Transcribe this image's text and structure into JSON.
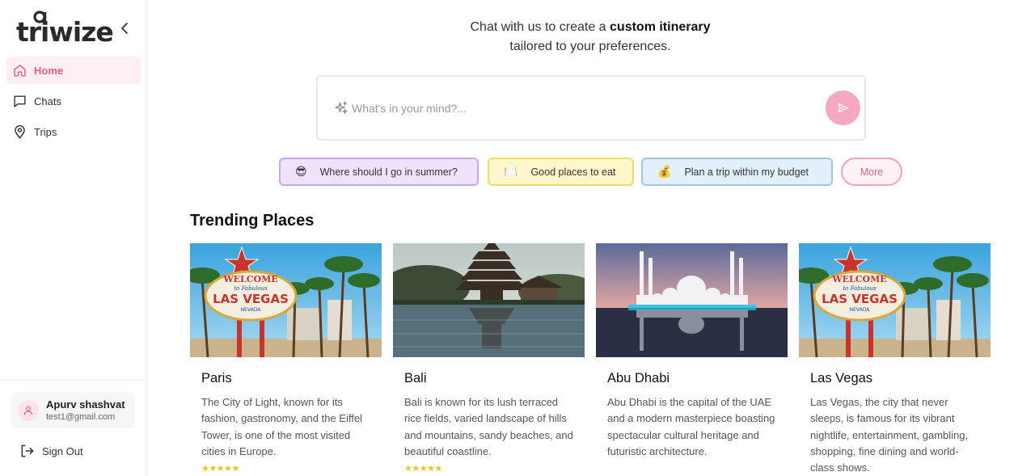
{
  "app": {
    "logo": "triwize"
  },
  "sidebar": {
    "items": [
      {
        "label": "Home",
        "icon": "home-icon",
        "active": true
      },
      {
        "label": "Chats",
        "icon": "chat-icon",
        "active": false
      },
      {
        "label": "Trips",
        "icon": "map-pin-icon",
        "active": false
      }
    ],
    "user": {
      "name": "Apurv shashvat",
      "email": "test1@gmail.com"
    },
    "signout_label": "Sign Out"
  },
  "main": {
    "headline_pre": "Chat with us to create a ",
    "headline_bold": "custom itinerary",
    "headline_post": "tailored to your preferences.",
    "chat": {
      "placeholder": "What's in your mind?..."
    },
    "chips": [
      {
        "emoji": "😎",
        "label": "Where should I go in summer?"
      },
      {
        "emoji": "🍽️",
        "label": "Good places to eat"
      },
      {
        "emoji": "💰",
        "label": "Plan a trip within my budget"
      }
    ],
    "more_label": "More",
    "section_title": "Trending Places",
    "cards": [
      {
        "title": "Paris",
        "description": "The City of Light, known for its fashion, gastronomy, and the Eiffel Tower, is one of the most visited cities in Europe.",
        "stars": "★★★★★",
        "image_text_1": "WELCOME",
        "image_text_2": "to Fabulous",
        "image_text_3": "LAS VEGAS",
        "image_text_4": "NEVADA"
      },
      {
        "title": "Bali",
        "description": "Bali is known for its lush terraced rice fields, varied landscape of hills and mountains, sandy beaches, and beautiful coastline.",
        "stars": "★★★★★"
      },
      {
        "title": "Abu Dhabi",
        "description": "Abu Dhabi is the capital of the UAE and a modern masterpiece boasting spectacular cultural heritage and futuristic architecture.",
        "stars": ""
      },
      {
        "title": "Las Vegas",
        "description": "Las Vegas, the city that never sleeps, is famous for its vibrant nightlife, entertainment, gambling, shopping, fine dining and world-class shows.",
        "stars": "",
        "image_text_1": "WELCOME",
        "image_text_2": "to Fabulous",
        "image_text_3": "LAS VEGAS",
        "image_text_4": "NEVADA"
      }
    ]
  },
  "colors": {
    "accent": "#e55b8b",
    "accent_light": "#fdeef3",
    "send": "#f7a8c1"
  }
}
